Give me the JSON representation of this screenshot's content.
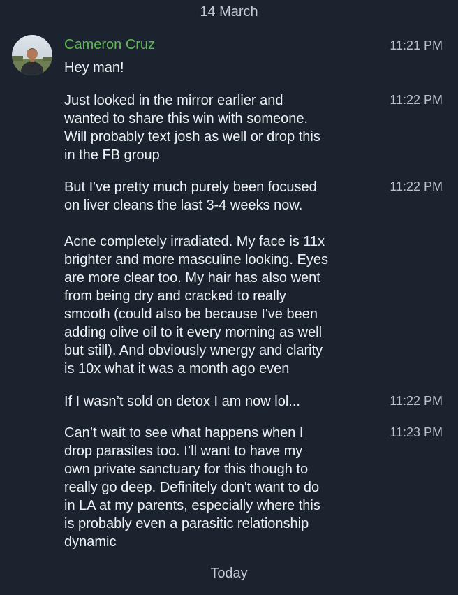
{
  "date_separators": {
    "top": "14 March",
    "bottom": "Today"
  },
  "sender": {
    "name": "Cameron Cruz",
    "name_color": "#5dbb4f"
  },
  "avatar": {
    "icon": "profile-photo"
  },
  "messages": [
    {
      "time": "11:21 PM",
      "text": "Hey man!"
    },
    {
      "time": "11:22 PM",
      "text": "Just looked in the mirror earlier and\nwanted to share this win with someone.\nWill probably text josh as well or drop this\nin the FB group"
    },
    {
      "time": "11:22 PM",
      "text": "But I've pretty much purely been focused\non liver cleans the last 3-4 weeks now."
    },
    {
      "time": "",
      "text": "Acne completely irradiated. My face is 11x\nbrighter and more masculine looking. Eyes\nare more clear too. My hair has also went\nfrom being dry and cracked to really\nsmooth (could also be because I've been\nadding olive oil to it every morning as well\nbut still). And obviously wnergy and clarity\nis 10x what it was a month ago even"
    },
    {
      "time": "11:22 PM",
      "text": "If I wasn’t sold on detox I am now lol..."
    },
    {
      "time": "11:23 PM",
      "text": "Can’t wait to see what happens when I\ndrop parasites too. I’ll want to have my\nown private sanctuary for this though to\nreally go deep. Definitely don't want to do\nin LA at my parents, especially where this\nis probably even a parasitic relationship\ndynamic"
    }
  ]
}
